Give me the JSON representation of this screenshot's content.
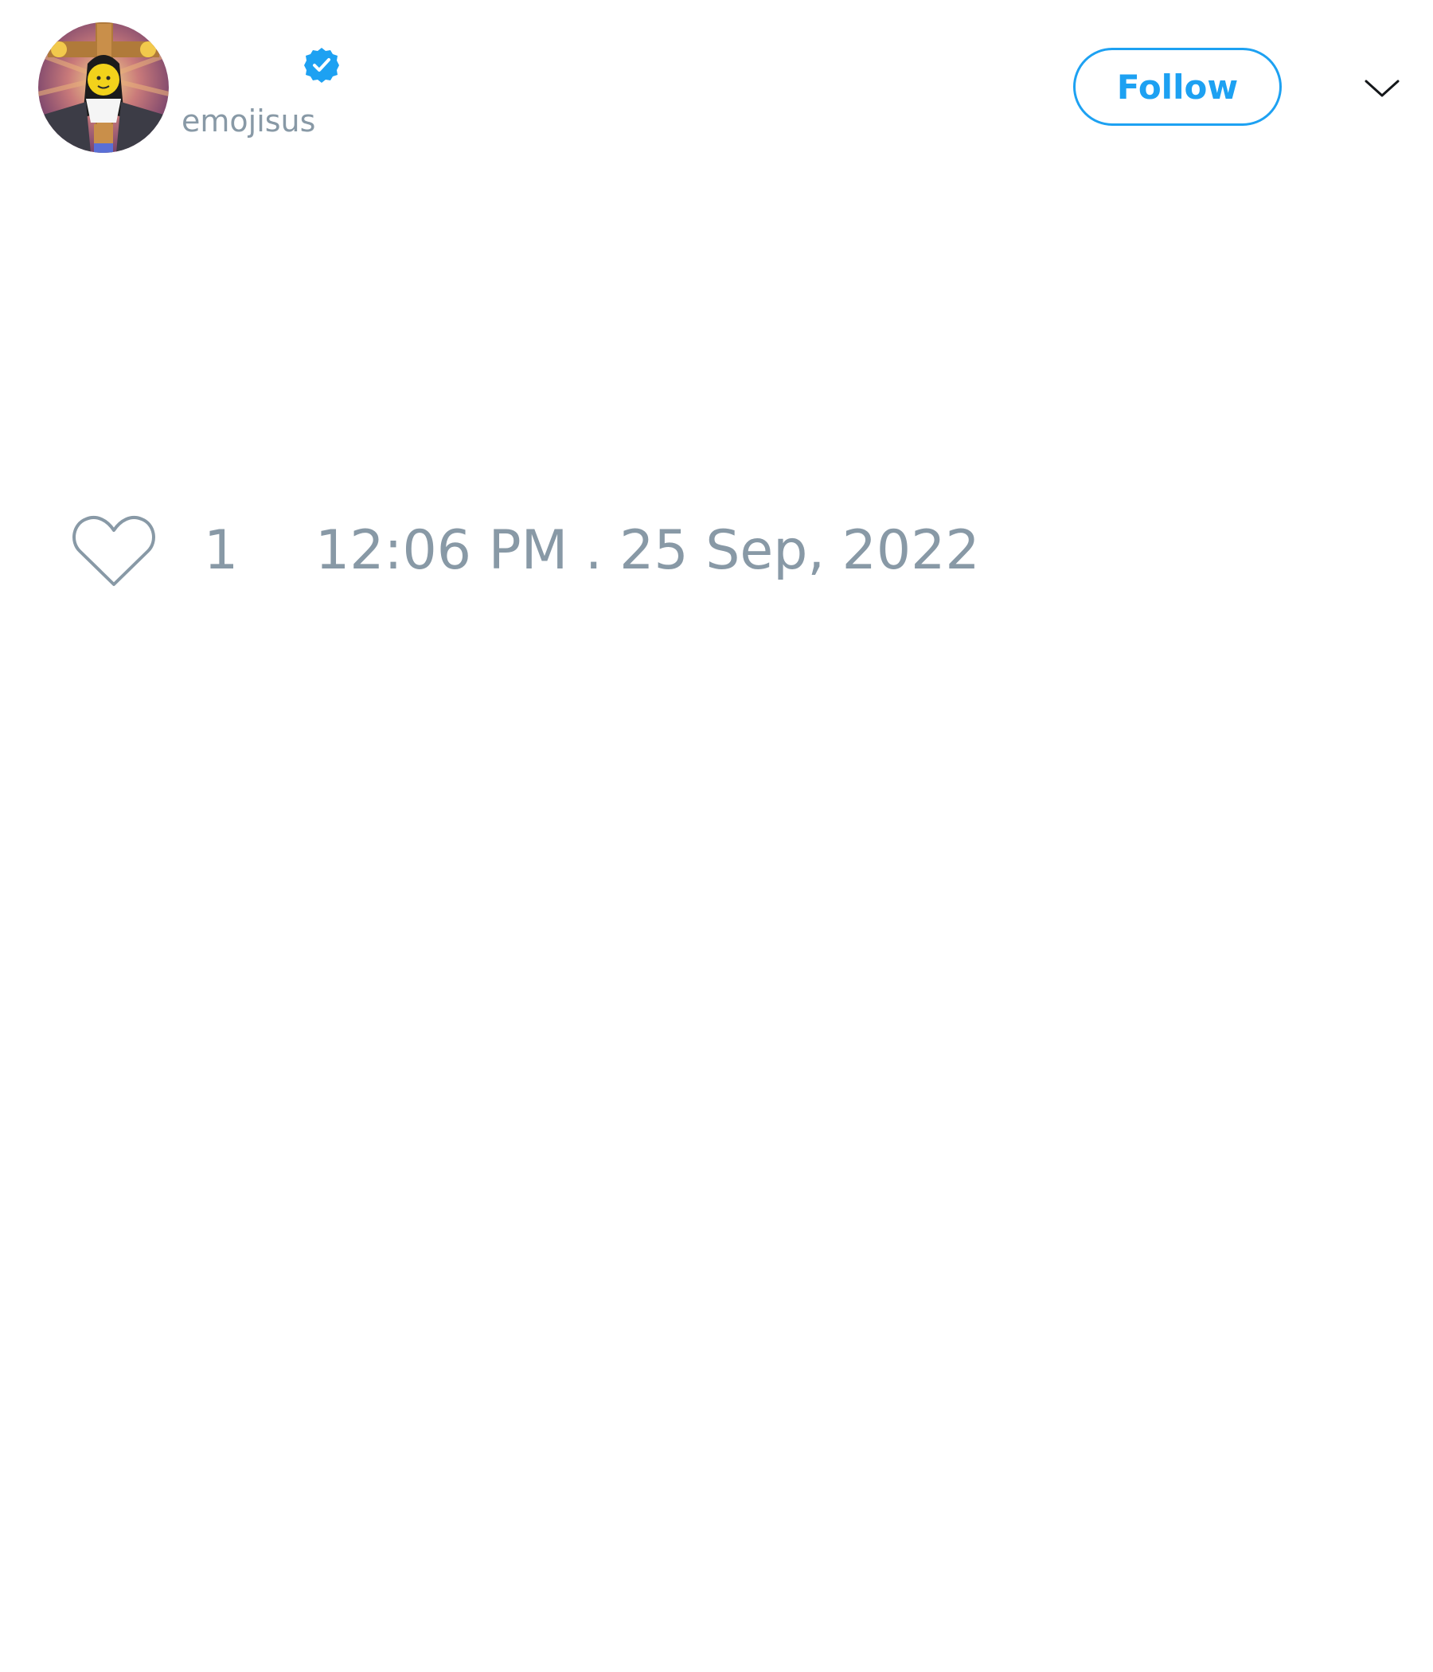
{
  "tweet": {
    "author": {
      "display_name": "",
      "username": "emojisus",
      "verified": true,
      "avatar_icon": "avatar-cross-figure-icon"
    },
    "follow_label": "Follow",
    "menu_icon": "chevron-down-icon",
    "text": "",
    "likes": "1",
    "timestamp": "12:06 PM . 25 Sep, 2022"
  },
  "colors": {
    "accent": "#1da1f2",
    "muted_text": "#8899a6",
    "heart_stroke": "#8899a6",
    "background": "#ffffff"
  }
}
